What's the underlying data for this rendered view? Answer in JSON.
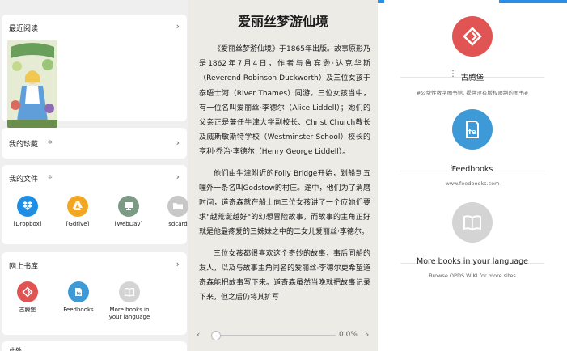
{
  "left": {
    "recent": {
      "title": "最近阅读"
    },
    "collection": {
      "title": "我的珍藏"
    },
    "files": {
      "title": "我的文件",
      "items": [
        {
          "label": "[Dropbox]",
          "icon": "dropbox-icon",
          "color": "#1f8fe6"
        },
        {
          "label": "[Gdrive]",
          "icon": "gdrive-icon",
          "color": "#f1a722"
        },
        {
          "label": "[WebDav]",
          "icon": "monitor-icon",
          "color": "#7c9a86"
        },
        {
          "label": "sdcard",
          "icon": "folder-icon",
          "color": "#c8c8c8"
        }
      ]
    },
    "library": {
      "title": "网上书库",
      "items": [
        {
          "label": "古腾堡",
          "color": "#e15454"
        },
        {
          "label": "Feedbooks",
          "color": "#3d9ad6"
        },
        {
          "label": "More books in your language",
          "color": "#d4d4d4"
        }
      ]
    },
    "partial_label": "此处"
  },
  "reader": {
    "title": "爱丽丝梦游仙境",
    "paragraphs": [
      "《爱丽丝梦游仙境》于1865年出版。故事原形乃是1862年7月4日，作者与鲁宾逊·达克华斯（Reverend Robinson Duckworth）及三位女孩于泰晤士河（River Thames）同游。三位女孩当中，有一位名叫爱丽丝·李德尔（Alice Liddell）；她们的父亲正是兼任牛津大学副校长、Christ Church教长及威斯敏斯特学校（Westminster School）校长的亨利·乔治·李德尔（Henry George Liddell）。",
      "他们由牛津附近的Folly Bridge开始，划船到五哩外一条名叫Godstow的村庄。途中，他们为了消磨时间，道奇森就在船上向三位女孩讲了一个应她们要求\"越荒诞越好\"的幻想冒险故事，而故事的主角正好就是他最疼爱的三姊妹之中的二女儿爱丽丝·李德尔。",
      "三位女孩都很喜欢这个奇妙的故事，事后同船的友人，以及与故事主角同名的爱丽丝·李德尔更希望道奇森能把故事写下来。道奇森虽然当晚就把故事记录下来，但之后仍将其扩写"
    ],
    "progress": "0.0%",
    "progress_value": 0.0
  },
  "sources": [
    {
      "name": "古腾堡",
      "desc": "#公益性数字图书馆, 提供没有版权限制的图书#",
      "color": "#e15454"
    },
    {
      "name": "Feedbooks",
      "desc": "www.feedbooks.com",
      "color": "#3d9ad6"
    },
    {
      "name": "More books in your language",
      "desc": "Browse OPDS WIKI for more sites",
      "color": "#d4d4d4"
    }
  ]
}
